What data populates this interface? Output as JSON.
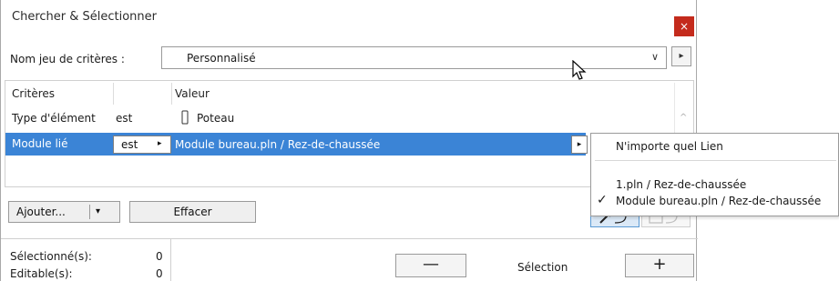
{
  "window": {
    "title": "Chercher & Sélectionner",
    "close_glyph": "×"
  },
  "criteria_set": {
    "label": "Nom jeu de critères :",
    "value": "Personnalisé",
    "chevron": "∨",
    "next_arrow": "▸"
  },
  "criteria_table": {
    "headers": {
      "criteria": "Critères",
      "value": "Valeur"
    },
    "rows": [
      {
        "criterion": "Type d'élément",
        "operator": "est",
        "value": "Poteau",
        "value_icon": "column-icon"
      },
      {
        "criterion": "Module lié",
        "operator": "est",
        "operator_arrow": "▸",
        "value": "Module bureau.pln / Rez-de-chaussée",
        "dropdown_arrow": "▸"
      }
    ],
    "scroll_up": "^"
  },
  "popup_menu": {
    "items": [
      {
        "label": "N'importe quel Lien",
        "checked": false
      },
      {
        "label": "1.pln / Rez-de-chaussée",
        "checked": false
      },
      {
        "label": "Module bureau.pln / Rez-de-chaussée",
        "checked": true
      }
    ],
    "check_glyph": "✓"
  },
  "buttons": {
    "add": "Ajouter...",
    "add_arrow": "▾",
    "clear": "Effacer"
  },
  "footer": {
    "selected_label": "Sélectionné(s):",
    "selected_count": "0",
    "editable_label": "Editable(s):",
    "editable_count": "0",
    "minus": "—",
    "selection_label": "Sélection",
    "plus": "+"
  },
  "colors": {
    "selection": "#3b84d6",
    "close": "#c42b1c"
  }
}
